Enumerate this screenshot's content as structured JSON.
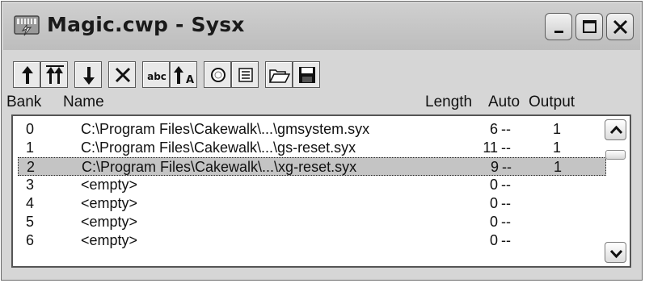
{
  "window": {
    "title": "Magic.cwp - Sysx",
    "app_icon": "keyboard-icon"
  },
  "caption_buttons": [
    "minimize-icon",
    "maximize-icon",
    "close-icon"
  ],
  "toolbar": {
    "buttons": [
      "arrow-up-icon",
      "arrow-up-multi-icon",
      "arrow-down-icon",
      "delete-x-icon",
      "abc-icon",
      "up-a-icon",
      "circle-icon",
      "list-icon",
      "open-folder-icon",
      "save-disk-icon"
    ],
    "abc_text": "abc",
    "a_text": "A"
  },
  "columns": {
    "bank": "Bank",
    "name": "Name",
    "length": "Length",
    "auto": "Auto",
    "output": "Output"
  },
  "rows": [
    {
      "bank": "0",
      "name": "C:\\Program Files\\Cakewalk\\...\\gmsystem.syx",
      "length": "6",
      "auto": "--",
      "output": "1"
    },
    {
      "bank": "1",
      "name": "C:\\Program Files\\Cakewalk\\...\\gs-reset.syx",
      "length": "11",
      "auto": "--",
      "output": "1"
    },
    {
      "bank": "2",
      "name": "C:\\Program Files\\Cakewalk\\...\\xg-reset.syx",
      "length": "9",
      "auto": "--",
      "output": "1"
    },
    {
      "bank": "3",
      "name": "<empty>",
      "length": "0",
      "auto": "--",
      "output": ""
    },
    {
      "bank": "4",
      "name": "<empty>",
      "length": "0",
      "auto": "--",
      "output": ""
    },
    {
      "bank": "5",
      "name": "<empty>",
      "length": "0",
      "auto": "--",
      "output": ""
    },
    {
      "bank": "6",
      "name": "<empty>",
      "length": "0",
      "auto": "--",
      "output": ""
    }
  ],
  "selected_row": 2,
  "colors": {
    "window_bg": "#d6d6d6",
    "selection_bg": "#c4c4c4"
  }
}
